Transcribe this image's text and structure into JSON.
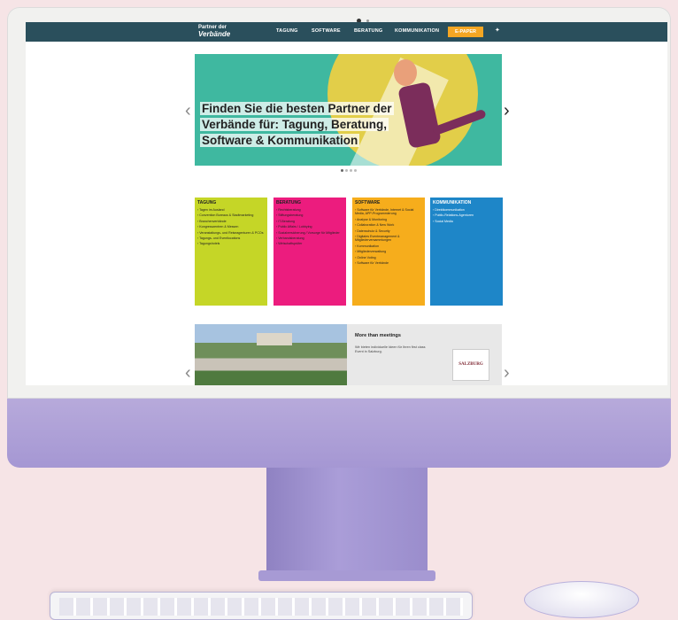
{
  "navbar": {
    "logo_line1": "Partner der",
    "logo_line2": "Verbände",
    "items": [
      "TAGUNG",
      "SOFTWARE",
      "BERATUNG",
      "KOMMUNIKATION"
    ],
    "epaper": "E-PAPER",
    "twitter_icon": "twitter-icon"
  },
  "hero": {
    "title_line1": "Finden Sie die besten Partner der",
    "title_line2": "Verbände für: Tagung, Beratung,",
    "title_line3": "Software & Kommunikation",
    "prev_icon": "‹",
    "next_icon": "›",
    "dots": 4,
    "active_dot": 0
  },
  "categories": [
    {
      "title": "TAGUNG",
      "color": "#c5d627",
      "items": [
        "Tagen im Ausland",
        "Convention Bureaus & Stadtmarketing",
        "Branchenverbände",
        "Kongresszentren & Messen",
        "Veranstaltungs- und Reiseagenturen & PCOs",
        "Tagungs- und Eventlocations",
        "Tagungshotels"
      ]
    },
    {
      "title": "BERATUNG",
      "color": "#ec1c7e",
      "items": [
        "Rechtsberatung",
        "Stiftungsberatung",
        "IT-Beratung",
        "Public Affairs / Lobbying",
        "Sozialversicherung / Vorsorge für Mitglieder",
        "Verbandsberatung",
        "Wirtschaftsprüfer"
      ]
    },
    {
      "title": "SOFTWARE",
      "color": "#f6ad1c",
      "items": [
        "Software für Verbände, Internet & Social Media, APP-Programmierung",
        "Analyse & Monitoring",
        "Collaboration & New Work",
        "Datenschutz & Security",
        "Digitales Eventmanagement & Mitgliederversammlungen",
        "Kommunikation",
        "Mitgliederverwaltung",
        "Online Voting",
        "Software für Verbände"
      ]
    },
    {
      "title": "KOMMUNIKATION",
      "color": "#1e86c8",
      "items": [
        "Direktkommunikation",
        "Public-Relations-Agenturen",
        "Social Media"
      ]
    }
  ],
  "promo": {
    "title": "More than meetings",
    "text": "Wir bieten individuelle Ideen für Ihren first class Event in Salzburg.",
    "logo": "SALZBURG"
  }
}
